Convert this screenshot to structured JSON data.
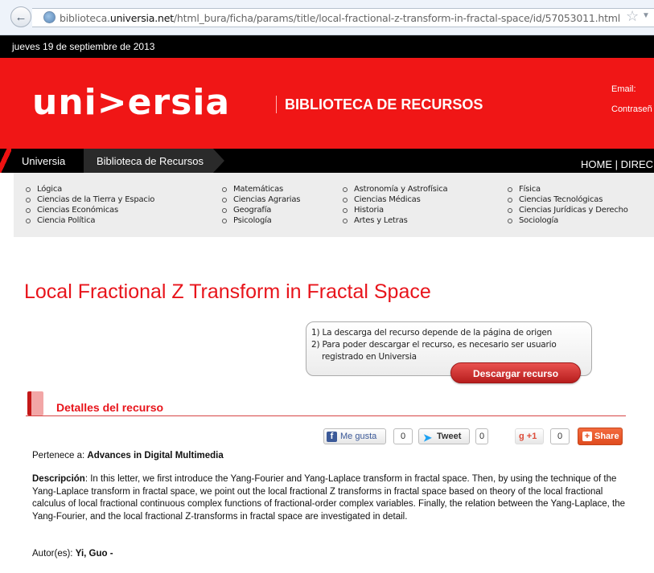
{
  "browser": {
    "url_prefix": "biblioteca.",
    "url_domain": "universia.net",
    "url_path": "/html_bura/ficha/params/title/local-fractional-z-transform-in-fractal-space/id/57053011.html"
  },
  "date_bar": {
    "text": "jueves 19 de septiembre de 2013"
  },
  "header": {
    "logo": "uni>ersia",
    "title": "BIBLIOTECA DE RECURSOS",
    "email_label": "Email:",
    "password_label": "Contraseñ"
  },
  "nav": {
    "home": "Universia",
    "current": "Biblioteca de Recursos",
    "right": "HOME | DIREC"
  },
  "categories": {
    "col1": [
      "Lógica",
      "Ciencias de la Tierra y Espacio",
      "Ciencias Económicas",
      "Ciencia Política"
    ],
    "col2": [
      "Matemáticas",
      "Ciencias Agrarias",
      "Geografía",
      "Psicología"
    ],
    "col3": [
      "Astronomía y Astrofísica",
      "Ciencias Médicas",
      "Historia",
      "Artes y Letras"
    ],
    "col4": [
      "Física",
      "Ciencias Tecnológicas",
      "Ciencias Jurídicas y Derecho",
      "Sociología"
    ]
  },
  "page_title": "Local Fractional Z Transform in Fractal Space",
  "download": {
    "line1": "1) La descarga del recurso depende de la página de origen",
    "line2": "2) Para poder descargar el recurso, es necesario ser usuario",
    "line3": "registrado en Universia",
    "button": "Descargar recurso"
  },
  "details_title": "Detalles del recurso",
  "social": {
    "fb_icon": "f",
    "fb_label": "Me gusta",
    "fb_count": "0",
    "tw_icon": "♥",
    "tw_label": "Tweet",
    "tw_count": "0",
    "gp_label": "+1",
    "gp_count": "0",
    "share_icon": "+",
    "share_label": "Share"
  },
  "resource": {
    "belongs_label": "Pertenece a:",
    "belongs_value": "Advances in Digital Multimedia",
    "desc_label": "Descripción",
    "desc_text": ": In this letter, we first introduce the Yang-Fourier and Yang-Laplace transform in fractal space. Then, by using the technique of the Yang-Laplace transform in fractal space, we point out the local fractional Z transforms in fractal space based on theory of the local fractional calculus of local fractional continuous complex functions of fractional-order complex variables. Finally, the relation between the Yang-Laplace, the Yang-Fourier, and the local fractional Z-transforms in fractal space are investigated in detail.",
    "author_label": "Autor(es):",
    "author_value": "Yi, Guo -"
  }
}
